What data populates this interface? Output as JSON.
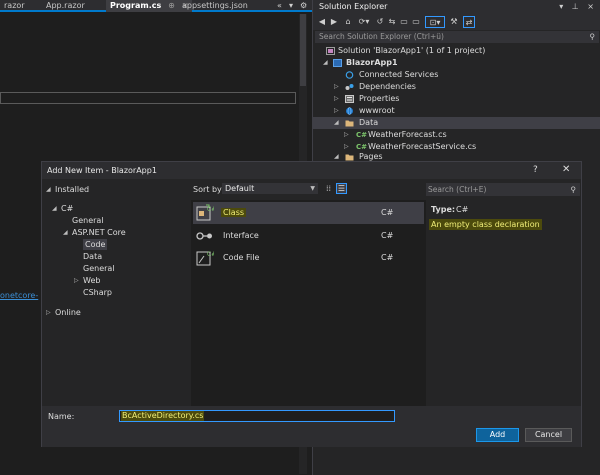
{
  "editor": {
    "tabs": [
      {
        "label": "razor",
        "active": false
      },
      {
        "label": "App.razor",
        "active": false
      },
      {
        "label": "Program.cs",
        "active": true
      },
      {
        "label": "appsettings.json",
        "active": false
      }
    ],
    "active_tab_pin_glyph": "⊕",
    "close_glyph": "×",
    "overflow_glyph": "«",
    "dropdown_glyph": "▾",
    "settings_glyph": "⚙",
    "code_snippet": "onetcore-"
  },
  "solution_explorer": {
    "title": "Solution Explorer",
    "title_controls": "▾ ⊥ ×",
    "search_placeholder": "Search Solution Explorer (Ctrl+ü)",
    "search_icon": "⚲",
    "tree": [
      {
        "label": "Solution 'BlazorApp1' (1 of 1 project)",
        "icon": "solution-icon",
        "bold": false
      },
      {
        "label": "BlazorApp1",
        "icon": "project-icon",
        "bold": true
      },
      {
        "label": "Connected Services",
        "icon": "connected-services-icon",
        "bold": false
      },
      {
        "label": "Dependencies",
        "icon": "dependencies-icon",
        "bold": false
      },
      {
        "label": "Properties",
        "icon": "properties-icon",
        "bold": false
      },
      {
        "label": "wwwroot",
        "icon": "globe-icon",
        "bold": false
      },
      {
        "label": "Data",
        "icon": "folder-icon",
        "bold": false
      },
      {
        "label": "WeatherForecast.cs",
        "icon": "csharp-file-icon",
        "bold": false
      },
      {
        "label": "WeatherForecastService.cs",
        "icon": "csharp-file-icon",
        "bold": false
      },
      {
        "label": "Pages",
        "icon": "folder-icon",
        "bold": false
      }
    ]
  },
  "dialog": {
    "title": "Add New Item - BlazorApp1",
    "help": "?",
    "close": "✕",
    "installed": "Installed",
    "online": "Online",
    "categories": {
      "csharp": "C#",
      "general": "General",
      "aspnet_core": "ASP.NET Core",
      "code": "Code",
      "data": "Data",
      "general2": "General",
      "web": "Web",
      "csharp_sub": "CSharp"
    },
    "sort_label": "Sort by:",
    "sort_value": "Default",
    "items": [
      {
        "name": "Class",
        "lang": "C#",
        "icon": "class-icon"
      },
      {
        "name": "Interface",
        "lang": "C#",
        "icon": "interface-icon"
      },
      {
        "name": "Code File",
        "lang": "C#",
        "icon": "code-file-icon"
      }
    ],
    "search_placeholder": "Search (Ctrl+E)",
    "search_icon": "⚲",
    "type_label": "Type:",
    "type_value": "C#",
    "description": "An empty class declaration",
    "name_label": "Name:",
    "name_value": "BcActiveDirectory.cs",
    "add_button": "Add",
    "cancel_button": "Cancel"
  },
  "colors": {
    "accent": "#007acc",
    "highlight_bg": "#4c4a0c",
    "highlight_text": "#f0ee78",
    "primary_button": "#0e639c"
  }
}
